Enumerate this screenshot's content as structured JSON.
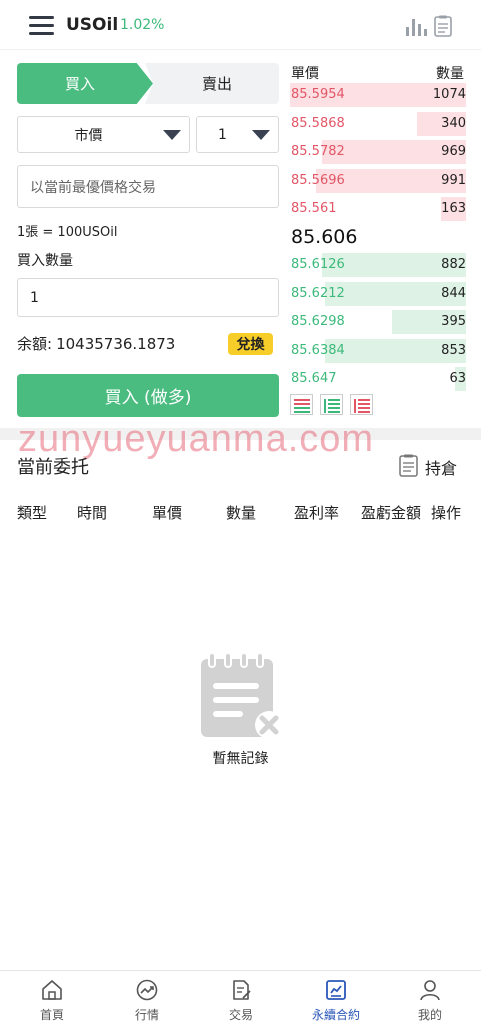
{
  "header": {
    "symbol": "USOil",
    "change": "1.02%"
  },
  "form": {
    "tab_buy": "買入",
    "tab_sell": "賣出",
    "order_type": "市價",
    "leverage": "1",
    "price_placeholder": "以當前最優價格交易",
    "unit_info": "1張 = 100USOil",
    "qty_label": "買入數量",
    "qty_value": "1",
    "balance_label": "余額:",
    "balance_value": "10435736.1873",
    "exchange_label": "兌換",
    "buy_button": "買入 (做多)"
  },
  "orderbook": {
    "price_header": "單價",
    "qty_header": "數量",
    "asks": [
      {
        "price": "85.5954",
        "qty": "1074",
        "depth": 1.0
      },
      {
        "price": "85.5868",
        "qty": "340",
        "depth": 0.28
      },
      {
        "price": "85.5782",
        "qty": "969",
        "depth": 0.82
      },
      {
        "price": "85.5696",
        "qty": "991",
        "depth": 0.85
      },
      {
        "price": "85.561",
        "qty": "163",
        "depth": 0.14
      }
    ],
    "last_price": "85.606",
    "bids": [
      {
        "price": "85.6126",
        "qty": "882",
        "depth": 0.82
      },
      {
        "price": "85.6212",
        "qty": "844",
        "depth": 0.8
      },
      {
        "price": "85.6298",
        "qty": "395",
        "depth": 0.42
      },
      {
        "price": "85.6384",
        "qty": "853",
        "depth": 0.8
      },
      {
        "price": "85.647",
        "qty": "63",
        "depth": 0.06
      }
    ]
  },
  "watermark": "zunyueyuanma.com",
  "orders": {
    "title": "當前委托",
    "hold_label": "持倉",
    "columns": [
      "類型",
      "時間",
      "單價",
      "數量",
      "盈利率",
      "盈虧金額",
      "操作"
    ],
    "empty_text": "暫無記錄"
  },
  "nav": {
    "items": [
      {
        "label": "首頁",
        "icon": "home-icon"
      },
      {
        "label": "行情",
        "icon": "market-icon"
      },
      {
        "label": "交易",
        "icon": "trade-icon"
      },
      {
        "label": "永續合約",
        "icon": "contract-icon",
        "active": true
      },
      {
        "label": "我的",
        "icon": "profile-icon"
      }
    ]
  },
  "colors": {
    "green": "#4bbc80",
    "red": "#e25666",
    "active_nav": "#2a57b8",
    "badge": "#f7cd2a"
  }
}
